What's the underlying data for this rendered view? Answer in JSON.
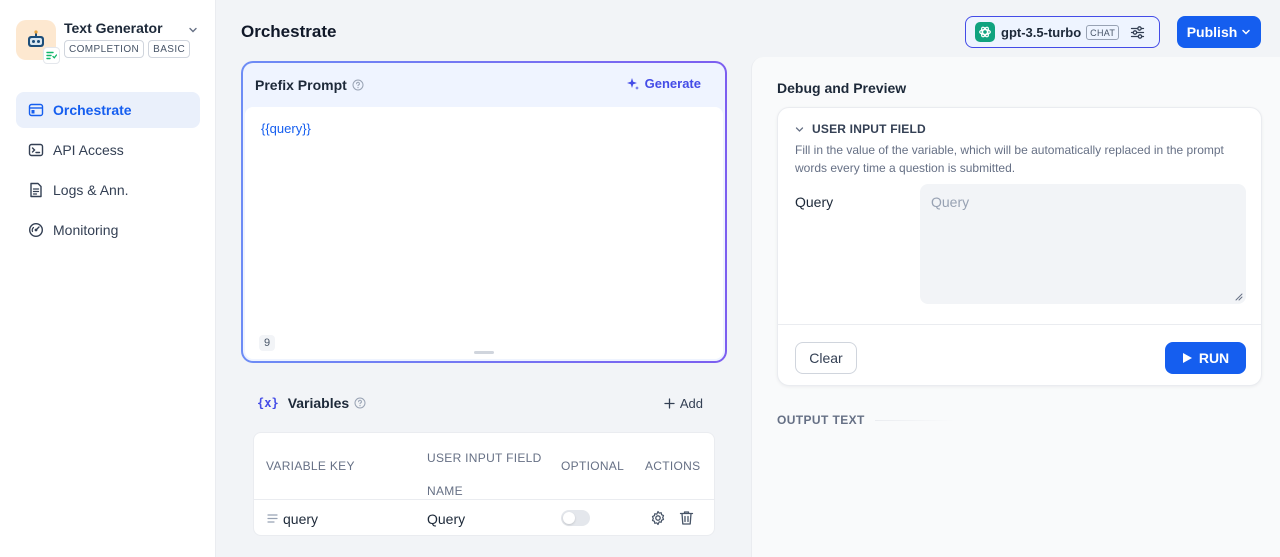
{
  "app": {
    "name": "Text Generator",
    "tags": [
      "COMPLETION",
      "BASIC"
    ]
  },
  "sidebar": {
    "items": [
      {
        "label": "Orchestrate",
        "icon": "orchestrate-icon",
        "active": true
      },
      {
        "label": "API Access",
        "icon": "terminal-icon",
        "active": false
      },
      {
        "label": "Logs & Ann.",
        "icon": "logs-icon",
        "active": false
      },
      {
        "label": "Monitoring",
        "icon": "monitoring-icon",
        "active": false
      }
    ]
  },
  "header": {
    "title": "Orchestrate",
    "model": {
      "name": "gpt-3.5-turbo",
      "mode": "CHAT"
    },
    "publish_label": "Publish"
  },
  "prompt": {
    "title": "Prefix Prompt",
    "generate_label": "Generate",
    "text": "{{query}}",
    "char_count": "9"
  },
  "variables": {
    "icon_text": "{x}",
    "title": "Variables",
    "add_label": "Add",
    "columns": [
      "VARIABLE KEY",
      "USER INPUT FIELD NAME",
      "OPTIONAL",
      "ACTIONS"
    ],
    "rows": [
      {
        "key": "query",
        "name": "Query",
        "optional": false
      }
    ]
  },
  "debug": {
    "title": "Debug and Preview",
    "input_field_title": "USER INPUT FIELD",
    "input_field_desc": "Fill in the value of the variable, which will be automatically replaced in the prompt words every time a question is submitted.",
    "query_label": "Query",
    "query_placeholder": "Query",
    "clear_label": "Clear",
    "run_label": "RUN",
    "output_label": "OUTPUT TEXT"
  },
  "colors": {
    "accent": "#155eef",
    "indigo": "#444ce7",
    "background": "#f2f4f7"
  }
}
